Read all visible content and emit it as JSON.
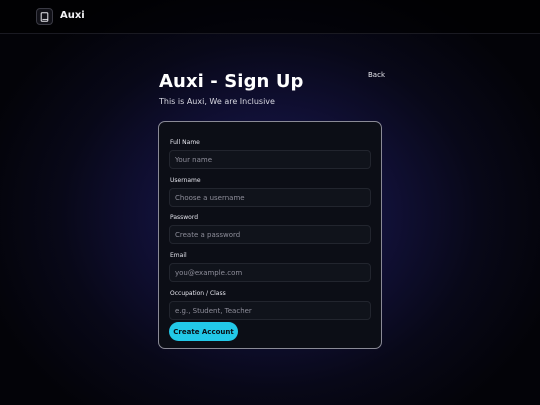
{
  "header": {
    "app_name": "Auxi",
    "logo_icon": "book-icon"
  },
  "page": {
    "title": "Auxi - Sign Up",
    "subtitle": "This is Auxi, We are Inclusive",
    "back_label": "Back"
  },
  "form": {
    "fields": [
      {
        "label": "Full Name",
        "placeholder": "Your name",
        "value": ""
      },
      {
        "label": "Username",
        "placeholder": "Choose a username",
        "value": ""
      },
      {
        "label": "Password",
        "placeholder": "Create a password",
        "value": ""
      },
      {
        "label": "Email",
        "placeholder": "you@example.com",
        "value": ""
      },
      {
        "label": "Occupation / Class",
        "placeholder": "e.g., Student, Teacher",
        "value": ""
      }
    ],
    "submit_label": "Create Account"
  },
  "colors": {
    "accent": "#22c8e8",
    "background": "#0b0b1f",
    "card_border": "#8a8a96"
  }
}
